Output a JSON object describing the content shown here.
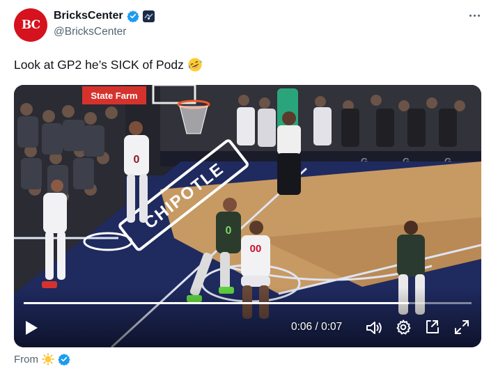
{
  "account": {
    "avatar_text": "BC",
    "display_name": "BricksCenter",
    "handle": "@BricksCenter"
  },
  "tweet": {
    "text": "Look at GP2 he’s SICK of Podz"
  },
  "video": {
    "time_display": "0:06 / 0:07",
    "progress": 0.86,
    "court_ad_text": "CHIPOTLE",
    "sign_text": "State Farm"
  },
  "footer": {
    "from_label": "From"
  },
  "colors": {
    "brand_red": "#d5121e",
    "verified_blue": "#1d9bf0",
    "text_secondary": "#536471"
  },
  "icons": {
    "verified": "verified-badge-icon",
    "more": "more-options-icon",
    "emoji": "rofl-emoji-icon",
    "play": "play-icon",
    "volume": "volume-icon",
    "settings": "gear-icon",
    "pip": "picture-in-picture-icon",
    "fullscreen": "fullscreen-icon"
  }
}
